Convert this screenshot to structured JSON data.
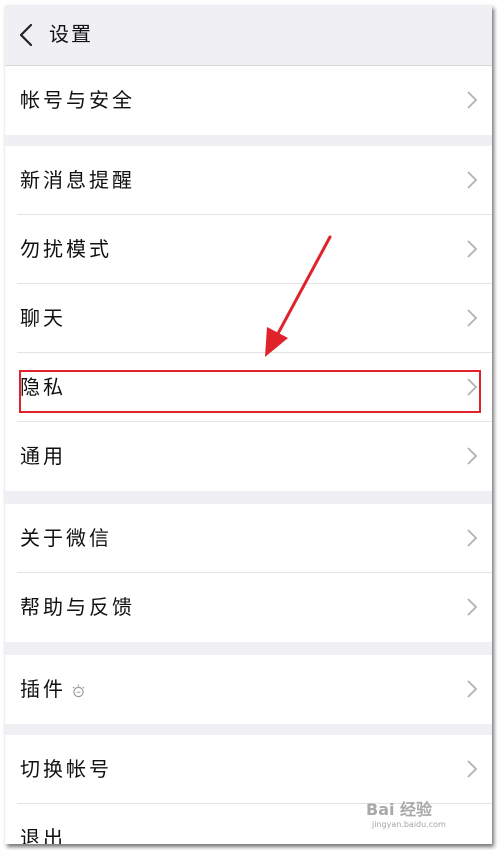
{
  "header": {
    "title": "设置",
    "back_icon": "chevron-left-icon"
  },
  "settings": {
    "account_security": "帐号与安全",
    "new_message_notify": "新消息提醒",
    "do_not_disturb": "勿扰模式",
    "chat": "聊天",
    "privacy": "隐私",
    "general": "通用",
    "about": "关于微信",
    "help_feedback": "帮助与反馈",
    "plugins": "插件",
    "switch_account": "切换帐号",
    "logout": "退出"
  },
  "annotation": {
    "highlight_color": "#e0222b",
    "arrow_color": "#e0222b"
  },
  "watermark": {
    "text": "Bai 经验",
    "url": "jingyan.baidu.com"
  }
}
